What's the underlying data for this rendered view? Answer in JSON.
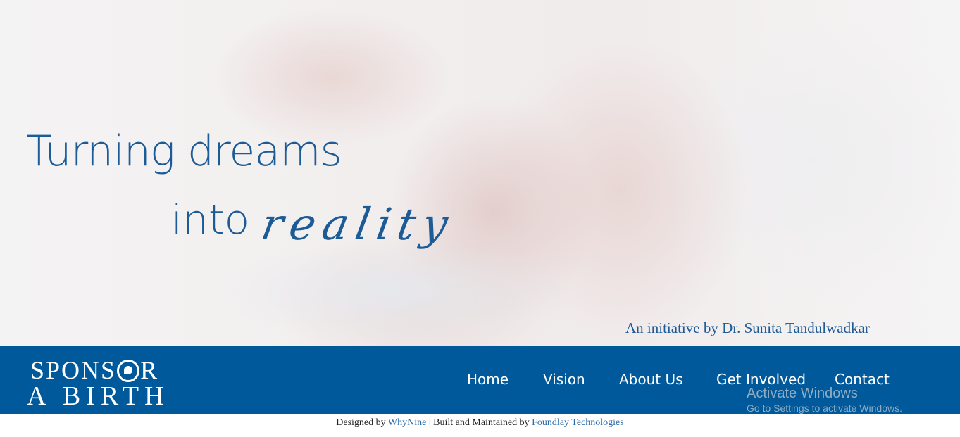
{
  "hero": {
    "headline_line1": "Turning dreams",
    "headline_line2_plain": "into",
    "headline_line2_script": "reality",
    "initiative": "An initiative by Dr. Sunita Tandulwadkar"
  },
  "logo": {
    "line1_before": "SPONS",
    "line1_after": "R",
    "line2": "A BIRTH",
    "icon": "fetus-in-circle-icon"
  },
  "nav": {
    "items": [
      "Home",
      "Vision",
      "About Us",
      "Get Involved",
      "Contact"
    ]
  },
  "watermark": {
    "title": "Activate Windows",
    "subtitle": "Go to Settings to activate Windows."
  },
  "footer": {
    "designed_by_prefix": "Designed by",
    "designer": "WhyNine",
    "separator": "|",
    "built_prefix": "Built and Maintained by",
    "builder": "Foundlay Technologies"
  },
  "colors": {
    "brand_blue": "#00599a",
    "headline_blue": "#1d5b97",
    "link_blue": "#2a6aa8"
  }
}
